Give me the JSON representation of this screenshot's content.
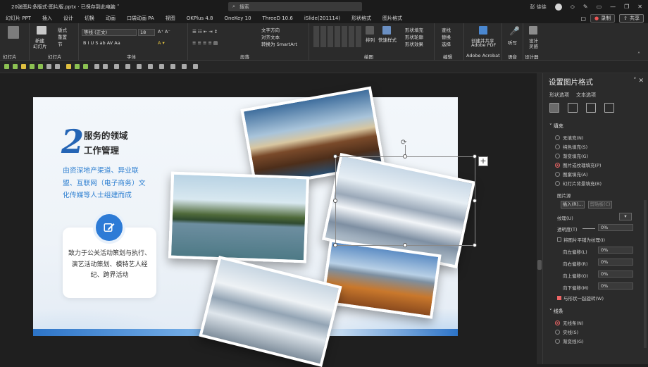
{
  "titlebar": {
    "doc_title": "20张图片多版式·图片版.pptx · 已保存到此电脑 ˅",
    "search_placeholder": "搜索",
    "user": "彭 徐徐"
  },
  "menubar": {
    "tabs": [
      {
        "label": "幻灯片 PPT"
      },
      {
        "label": "插入"
      },
      {
        "label": "设计"
      },
      {
        "label": "切换"
      },
      {
        "label": "动画"
      },
      {
        "label": "口袋动画 PA"
      },
      {
        "label": "视图"
      },
      {
        "label": "OKPlus 4.8"
      },
      {
        "label": "OneKey 10"
      },
      {
        "label": "ThreeD 10.6"
      },
      {
        "label": "iSlide(201114)"
      },
      {
        "label": "形状格式"
      },
      {
        "label": "图片格式"
      }
    ],
    "record_label": "录制",
    "share_label": "共享"
  },
  "ribbon": {
    "groups": [
      {
        "label": "幻灯片"
      },
      {
        "label": "幻灯片"
      },
      {
        "label": "字体"
      },
      {
        "label": "段落"
      },
      {
        "label": "绘图"
      },
      {
        "label": "编辑"
      },
      {
        "label": "Adobe Acrobat"
      },
      {
        "label": "语音"
      },
      {
        "label": "设计器"
      }
    ],
    "font_name": "等线 (正文)",
    "font_size": "18",
    "layout": "版式",
    "reset": "重置",
    "section": "节",
    "new_slide_1": "新建",
    "new_slide_2": "幻灯片",
    "reuse_1": "重用",
    "reuse_2": "幻灯片",
    "text_direction": "文字方向",
    "align_text": "对齐文本",
    "smartart": "转换为 SmartArt",
    "arrange": "排列",
    "quick_styles": "快速样式",
    "shape_fill": "形状填充",
    "shape_outline": "形状轮廓",
    "shape_effects": "形状效果",
    "find": "查找",
    "replace": "替换",
    "select": "选择",
    "acrobat_1": "创建并共享",
    "acrobat_2": "Adobe PDF",
    "dictate": "听写",
    "designer": "设计",
    "designer_2": "灵感"
  },
  "slide": {
    "big_number": "2",
    "heading_line1": "服务的领域",
    "heading_line2": "工作管理",
    "blue_text": "由资深地产渠道、异业联盟、互联网（电子商务）文化传媒等人士组建而成",
    "card_text": "致力于公关活动策划与执行、演艺活动策划、模特艺人经纪、跨界活动"
  },
  "pane": {
    "title": "设置图片格式",
    "tab1": "形状选项",
    "tab2": "文本选项",
    "fill_section": "填充",
    "fill_options": [
      {
        "label": "无填充(N)",
        "selected": false
      },
      {
        "label": "纯色填充(S)",
        "selected": false
      },
      {
        "label": "渐变填充(G)",
        "selected": false
      },
      {
        "label": "图片或纹理填充(P)",
        "selected": true
      },
      {
        "label": "图案填充(A)",
        "selected": false
      },
      {
        "label": "幻灯片背景填充(B)",
        "selected": false
      }
    ],
    "picture_source": "图片源",
    "insert_btn": "插入(R)...",
    "clipboard_btn": "剪贴板(C)",
    "texture_label": "纹理(U)",
    "transparency_label": "透明度(T)",
    "transparency_value": "0%",
    "tile_label": "将图片平铺为纹理(I)",
    "offset_left_label": "向左偏移(L)",
    "offset_left_value": "0%",
    "offset_right_label": "向右偏移(R)",
    "offset_right_value": "0%",
    "offset_top_label": "向上偏移(O)",
    "offset_top_value": "0%",
    "offset_bottom_label": "向下偏移(M)",
    "offset_bottom_value": "0%",
    "rotate_label": "与形状一起旋转(W)",
    "line_section": "线条",
    "line_options": [
      {
        "label": "无线条(N)",
        "selected": true
      },
      {
        "label": "实线(S)",
        "selected": false
      },
      {
        "label": "渐变线(G)",
        "selected": false
      }
    ]
  }
}
